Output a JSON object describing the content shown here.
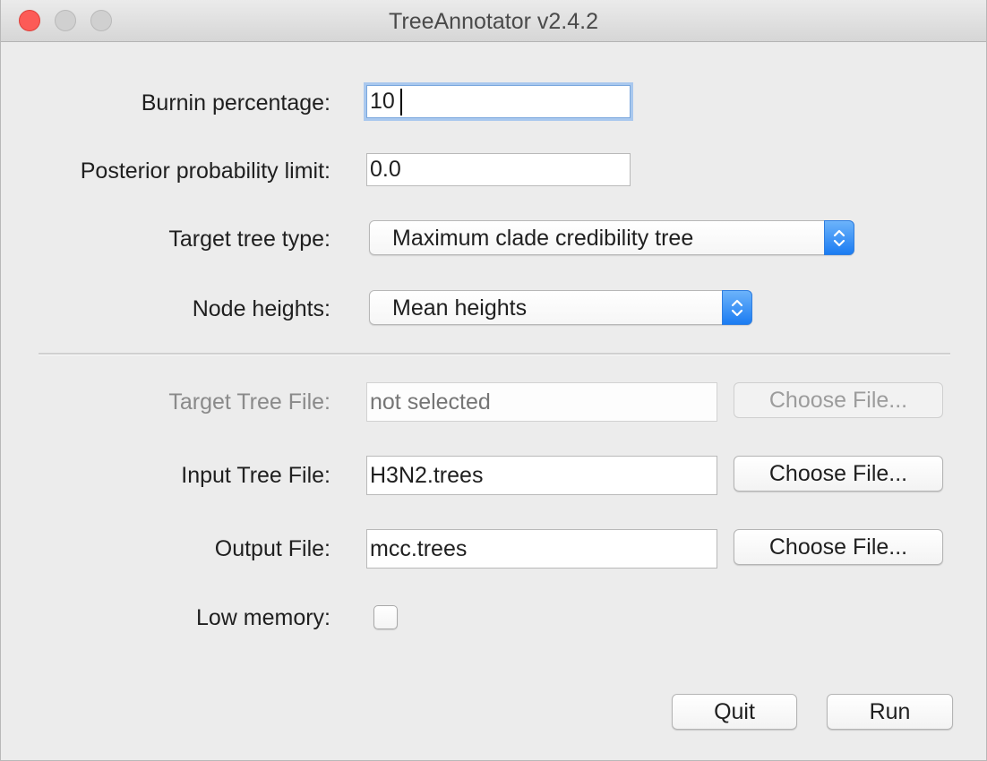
{
  "window": {
    "title": "TreeAnnotator v2.4.2"
  },
  "form": {
    "burnin": {
      "label": "Burnin percentage:",
      "value": "10"
    },
    "posterior_limit": {
      "label": "Posterior probability limit:",
      "value": "0.0"
    },
    "target_tree_type": {
      "label": "Target tree type:",
      "selected": "Maximum clade credibility tree"
    },
    "node_heights": {
      "label": "Node heights:",
      "selected": "Mean heights"
    },
    "target_tree_file": {
      "label": "Target Tree File:",
      "placeholder": "not selected",
      "button_label": "Choose File..."
    },
    "input_tree_file": {
      "label": "Input Tree File:",
      "value": "H3N2.trees",
      "button_label": "Choose File..."
    },
    "output_file": {
      "label": "Output File:",
      "value": "mcc.trees",
      "button_label": "Choose File..."
    },
    "low_memory": {
      "label": "Low memory:",
      "checked": false
    }
  },
  "actions": {
    "quit_label": "Quit",
    "run_label": "Run"
  },
  "colors": {
    "close": "#fc5b57",
    "select_accent": "#1b7cf2",
    "focus_ring": "#a9c8ee"
  }
}
